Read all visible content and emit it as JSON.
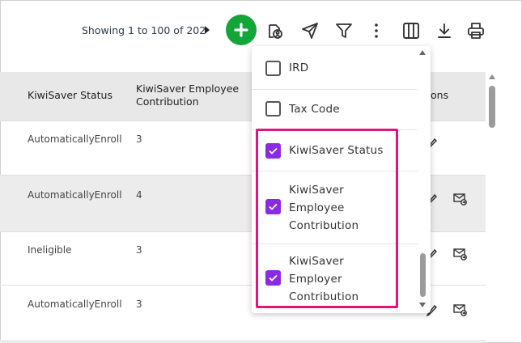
{
  "toolbar": {
    "showing_text": "Showing 1 to 100 of 202",
    "icons": [
      "next-page-icon",
      "add-icon",
      "user-profile-icon",
      "send-icon",
      "filter-icon",
      "more-vert-icon",
      "columns-icon",
      "download-icon",
      "print-icon"
    ]
  },
  "table": {
    "headers": {
      "kiwisaver_status": "KiwiSaver Status",
      "kiwisaver_employee_contribution_line1": "KiwiSaver Employee",
      "kiwisaver_employee_contribution_line2": "Contribution",
      "actions": "ons"
    },
    "rows": [
      {
        "status": "AutomaticallyEnroll",
        "employee_contribution": "3"
      },
      {
        "status": "AutomaticallyEnroll",
        "employee_contribution": "4"
      },
      {
        "status": "Ineligible",
        "employee_contribution": "3"
      },
      {
        "status": "AutomaticallyEnroll",
        "employee_contribution": "3"
      }
    ]
  },
  "column_menu": {
    "items": [
      {
        "label_lines": [
          "IRD"
        ],
        "checked": false
      },
      {
        "label_lines": [
          "Tax Code"
        ],
        "checked": false
      },
      {
        "label_lines": [
          "KiwiSaver Status"
        ],
        "checked": true
      },
      {
        "label_lines": [
          "KiwiSaver",
          "Employee",
          "Contribution"
        ],
        "checked": true
      },
      {
        "label_lines": [
          "KiwiSaver",
          "Employer",
          "Contribution"
        ],
        "checked": true
      }
    ]
  },
  "colors": {
    "add_button": "#13a538",
    "checkbox_checked": "#8a2be2",
    "highlight_border": "#e0157a",
    "header_bg": "#e8e8e8"
  }
}
